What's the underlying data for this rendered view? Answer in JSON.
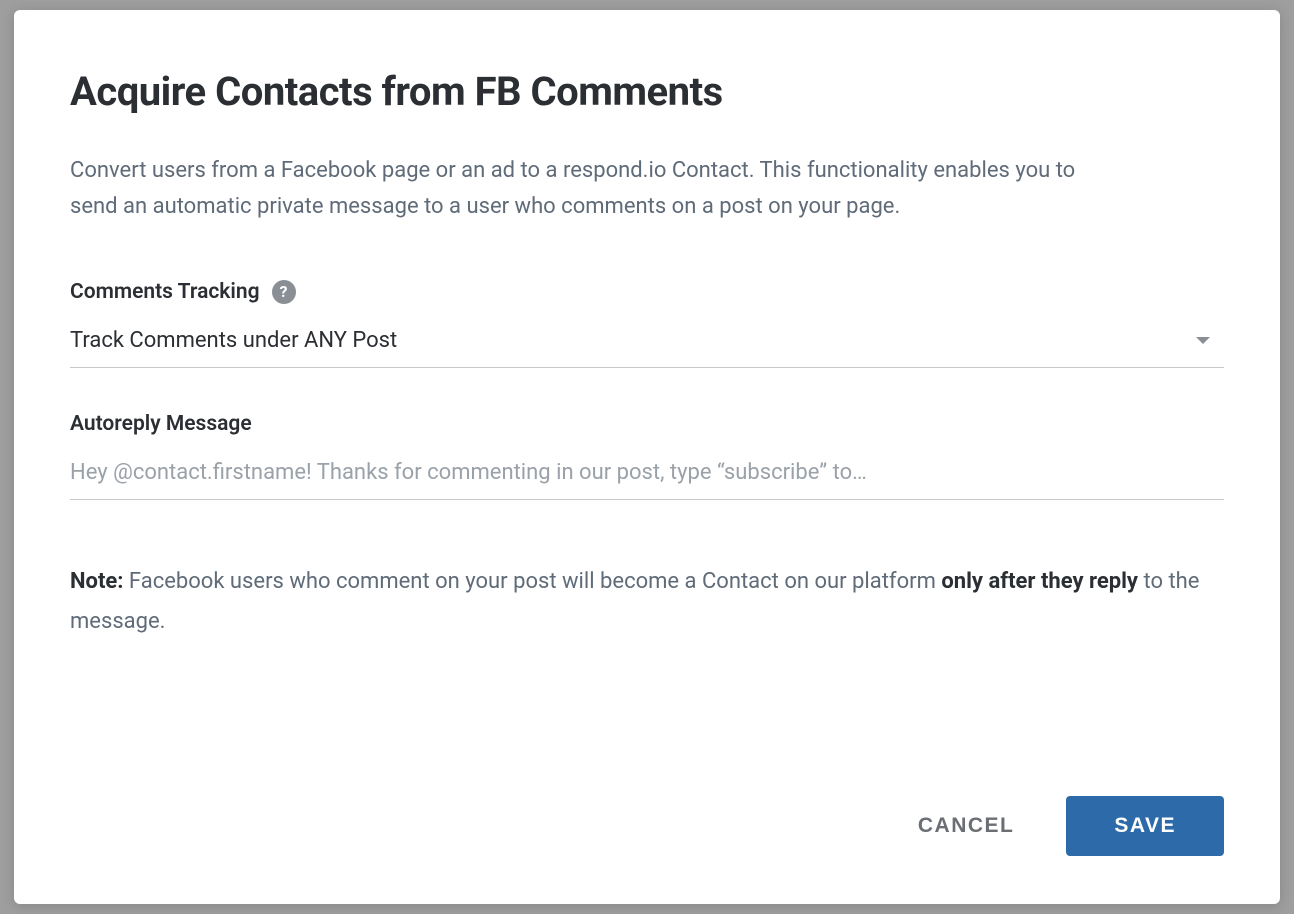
{
  "modal": {
    "title": "Acquire Contacts from FB Comments",
    "description": "Convert users from a Facebook page or an ad to a respond.io Contact. This functionality enables you to send an automatic private message to a user who comments on a post on your page.",
    "fields": {
      "comments_tracking": {
        "label": "Comments Tracking",
        "selected": "Track Comments under ANY Post"
      },
      "autoreply": {
        "label": "Autoreply Message",
        "placeholder": "Hey @contact.firstname! Thanks for commenting in our post, type “subscribe” to…",
        "value": ""
      }
    },
    "note": {
      "prefix": "Note:",
      "body_part1": " Facebook users who comment on your post will become a Contact on our platform ",
      "strong": "only after they reply",
      "body_part2": " to the message."
    },
    "actions": {
      "cancel": "CANCEL",
      "save": "SAVE"
    }
  }
}
